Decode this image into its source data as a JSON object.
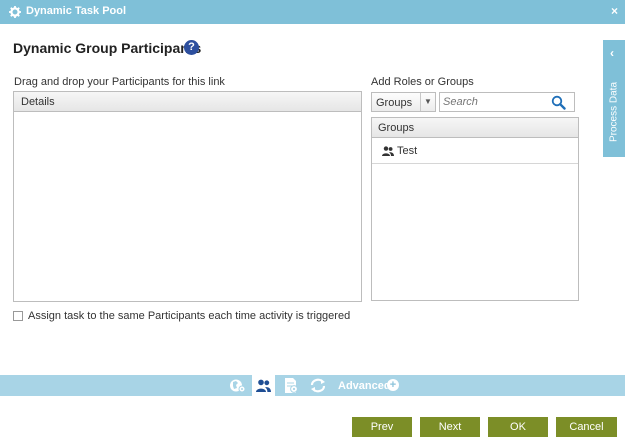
{
  "window": {
    "title": "Dynamic Task Pool",
    "close_symbol": "×"
  },
  "header": {
    "title": "Dynamic Group Participants",
    "help_symbol": "?"
  },
  "participants": {
    "instruction": "Drag and drop your Participants for this link",
    "column_header": "Details"
  },
  "roles_groups": {
    "label": "Add Roles or Groups",
    "type_select": {
      "value": "Groups",
      "arrow": "▼"
    },
    "search": {
      "placeholder": "Search",
      "value": ""
    },
    "list_header": "Groups",
    "items": [
      {
        "label": "Test",
        "icon": "users-icon"
      }
    ]
  },
  "assign_checkbox": {
    "label": "Assign task to the same Participants each time activity is triggered",
    "checked": false
  },
  "process_data": {
    "label": "Process Data",
    "chevron": "‹"
  },
  "toolbar": {
    "advanced_label": "Advanced",
    "plus_symbol": "+",
    "active_tab": "participants"
  },
  "buttons": {
    "prev": "Prev",
    "next": "Next",
    "ok": "OK",
    "cancel": "Cancel"
  },
  "colors": {
    "titlebar": "#7fc0d8",
    "toolbar": "#a8d4e6",
    "button": "#7c8e27",
    "help": "#2d4f9e"
  }
}
